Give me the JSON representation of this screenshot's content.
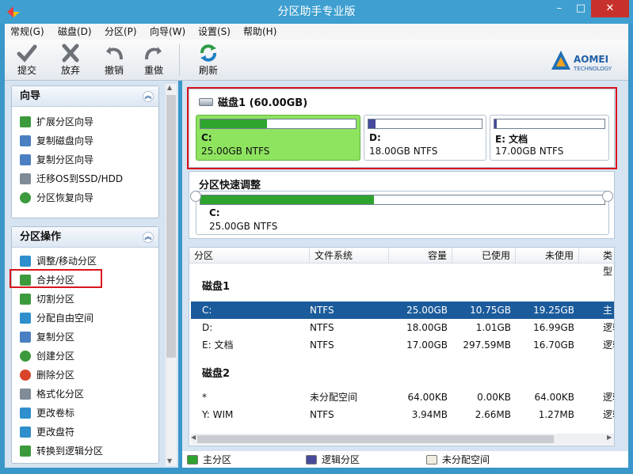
{
  "window": {
    "title": "分区助手专业版",
    "min": "–",
    "max": "□",
    "close": "✕"
  },
  "menu": [
    "常规(G)",
    "磁盘(D)",
    "分区(P)",
    "向导(W)",
    "设置(S)",
    "帮助(H)"
  ],
  "toolbar": {
    "buttons": [
      "提交",
      "放弃",
      "撤销",
      "重做",
      "刷新"
    ],
    "logo_line1": "AOMEI",
    "logo_line2": "TECHNOLOGY"
  },
  "wizard_panel": {
    "title": "向导",
    "items": [
      "扩展分区向导",
      "复制磁盘向导",
      "复制分区向导",
      "迁移OS到SSD/HDD",
      "分区恢复向导"
    ]
  },
  "operations_panel": {
    "title": "分区操作",
    "items": [
      "调整/移动分区",
      "合并分区",
      "切割分区",
      "分配自由空间",
      "复制分区",
      "创建分区",
      "删除分区",
      "格式化分区",
      "更改卷标",
      "更改盘符",
      "转换到逻辑分区"
    ]
  },
  "diskmap": {
    "title": "磁盘1 (60.00GB)",
    "partitions": [
      {
        "label": "C:",
        "size": "25.00GB NTFS",
        "used_fraction": 0.43,
        "color": "#2ea42e"
      },
      {
        "label": "D:",
        "size": "18.00GB NTFS",
        "used_fraction": 0.06,
        "color": "#474a9a"
      },
      {
        "label": "E: 文档",
        "size": "17.00GB NTFS",
        "used_fraction": 0.02,
        "color": "#474a9a"
      }
    ]
  },
  "quick": {
    "title": "分区快速调整",
    "label": "C:",
    "size": "25.00GB NTFS",
    "used_fraction": 0.43
  },
  "table": {
    "columns": [
      "分区",
      "文件系统",
      "容量",
      "已使用",
      "未使用",
      "类型"
    ],
    "groups": [
      {
        "name": "磁盘1",
        "rows": [
          {
            "cells": [
              "C:",
              "NTFS",
              "25.00GB",
              "10.75GB",
              "19.25GB",
              "主"
            ],
            "selected": true
          },
          {
            "cells": [
              "D:",
              "NTFS",
              "18.00GB",
              "1.01GB",
              "16.99GB",
              "逻辑"
            ],
            "selected": false
          },
          {
            "cells": [
              "E: 文档",
              "NTFS",
              "17.00GB",
              "297.59MB",
              "16.70GB",
              "逻辑"
            ],
            "selected": false
          }
        ]
      },
      {
        "name": "磁盘2",
        "rows": [
          {
            "cells": [
              "*",
              "未分配空间",
              "64.00KB",
              "0.00KB",
              "64.00KB",
              "逻辑"
            ],
            "selected": false
          },
          {
            "cells": [
              "Y: WIM",
              "NTFS",
              "3.94MB",
              "2.66MB",
              "1.27MB",
              "逻辑"
            ],
            "selected": false
          }
        ]
      }
    ]
  },
  "legend": [
    {
      "label": "主分区",
      "color": "#2ea42e"
    },
    {
      "label": "逻辑分区",
      "color": "#474a9a"
    },
    {
      "label": "未分配空间",
      "color": "#f2ede2"
    }
  ],
  "colors": {
    "highlight": "#d9151d",
    "selection": "#1b5b9b",
    "primary_free": "#8ee35f"
  }
}
